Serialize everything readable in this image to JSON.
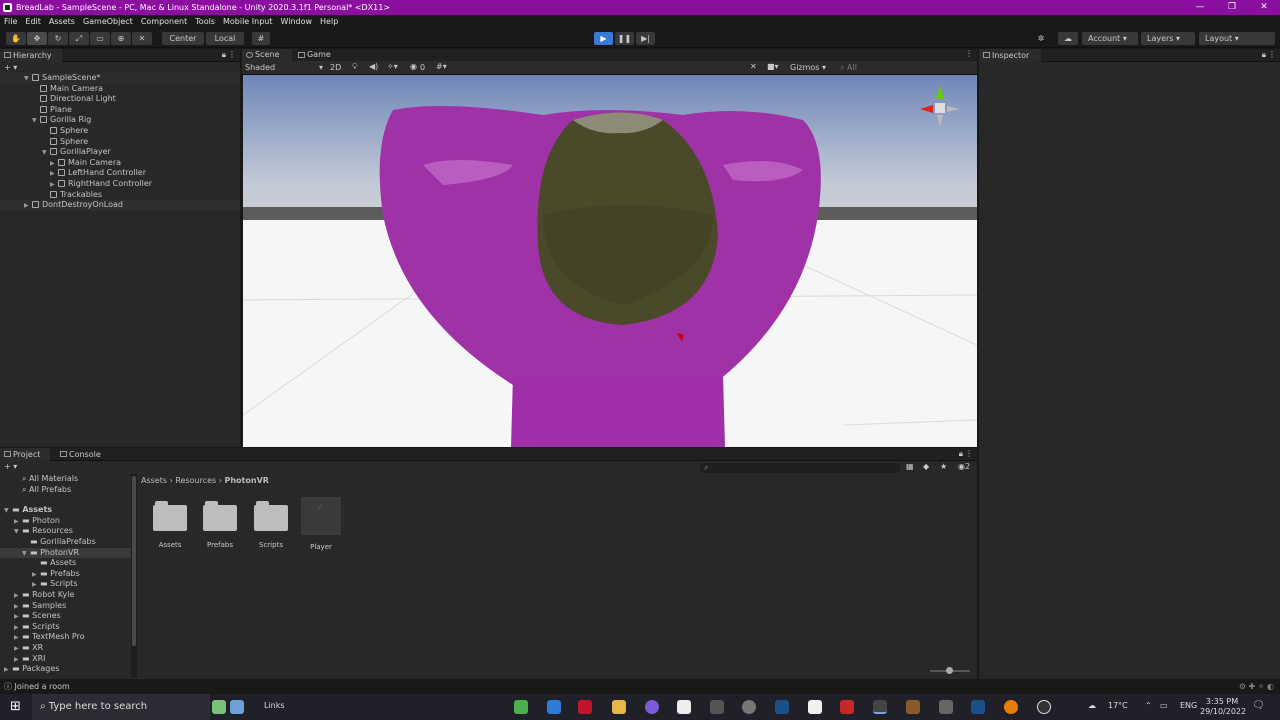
{
  "window": {
    "title": "BreadLab - SampleScene - PC, Mac & Linux Standalone - Unity 2020.3.1f1 Personal* <DX11>",
    "controls": [
      "—",
      "❐",
      "✕"
    ]
  },
  "menu": [
    "File",
    "Edit",
    "Assets",
    "GameObject",
    "Component",
    "Tools",
    "Mobile Input",
    "Window",
    "Help"
  ],
  "toolbar": {
    "center": "Center",
    "local": "Local",
    "account": "Account",
    "layers": "Layers",
    "layout": "Layout"
  },
  "hierarchy": {
    "tab": "Hierarchy",
    "items": [
      {
        "label": "SampleScene*",
        "depth": 0
      },
      {
        "label": "Main Camera",
        "depth": 1
      },
      {
        "label": "Directional Light",
        "depth": 1
      },
      {
        "label": "Plane",
        "depth": 1
      },
      {
        "label": "Gorilla Rig",
        "depth": 1
      },
      {
        "label": "Sphere",
        "depth": 2
      },
      {
        "label": "Sphere",
        "depth": 2
      },
      {
        "label": "GorillaPlayer",
        "depth": 2
      },
      {
        "label": "Main Camera",
        "depth": 3
      },
      {
        "label": "LeftHand Controller",
        "depth": 3
      },
      {
        "label": "RightHand Controller",
        "depth": 3
      },
      {
        "label": "Trackables",
        "depth": 2
      },
      {
        "label": "DontDestroyOnLoad",
        "depth": 0
      }
    ]
  },
  "scene": {
    "tabs": [
      "Scene",
      "Game"
    ],
    "shading": "Shaded",
    "mode2d": "2D",
    "gizmos": "Gizmos",
    "search": "All",
    "fx_count": "0"
  },
  "inspector": {
    "tab": "Inspector"
  },
  "project": {
    "tabs": [
      "Project",
      "Console"
    ],
    "favorites": [
      "All Materials",
      "All Prefabs"
    ],
    "tree": [
      {
        "label": "Assets",
        "depth": 0
      },
      {
        "label": "Photon",
        "depth": 1
      },
      {
        "label": "Resources",
        "depth": 1
      },
      {
        "label": "GorillaPrefabs",
        "depth": 2
      },
      {
        "label": "PhotonVR",
        "depth": 2
      },
      {
        "label": "Assets",
        "depth": 3
      },
      {
        "label": "Prefabs",
        "depth": 3
      },
      {
        "label": "Scripts",
        "depth": 3
      },
      {
        "label": "Robot Kyle",
        "depth": 1
      },
      {
        "label": "Samples",
        "depth": 1
      },
      {
        "label": "Scenes",
        "depth": 1
      },
      {
        "label": "Scripts",
        "depth": 1
      },
      {
        "label": "TextMesh Pro",
        "depth": 1
      },
      {
        "label": "XR",
        "depth": 1
      },
      {
        "label": "XRI",
        "depth": 1
      },
      {
        "label": "Packages",
        "depth": 0
      }
    ],
    "breadcrumb": [
      "Assets",
      "Resources",
      "PhotonVR"
    ],
    "files": [
      "Assets",
      "Prefabs",
      "Scripts",
      "Player"
    ],
    "hidden_count": "2"
  },
  "status": "Joined a room",
  "taskbar": {
    "search": "Type here to search",
    "links": "Links",
    "temp": "17°C",
    "lang": "ENG",
    "time": "3:35 PM",
    "date": "29/10/2022"
  }
}
